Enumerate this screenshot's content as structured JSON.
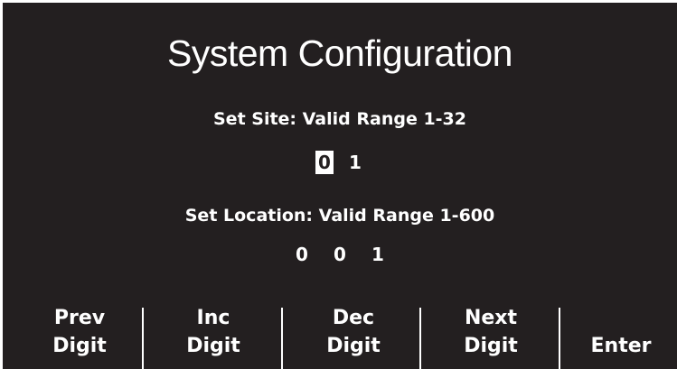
{
  "title": "System Configuration",
  "site": {
    "label": "Set Site: Valid Range 1-32",
    "digits": [
      "0",
      "1"
    ],
    "selected_index": 0
  },
  "location": {
    "label": "Set Location: Valid Range 1-600",
    "digits": [
      "0",
      "0",
      "1"
    ]
  },
  "softkeys": {
    "prev": {
      "line1": "Prev",
      "line2": "Digit"
    },
    "inc": {
      "line1": "Inc",
      "line2": "Digit"
    },
    "dec": {
      "line1": "Dec",
      "line2": "Digit"
    },
    "next": {
      "line1": "Next",
      "line2": "Digit"
    },
    "enter": {
      "line1": "",
      "line2": "Enter"
    }
  },
  "colors": {
    "background": "#231f20",
    "foreground": "#ffffff"
  }
}
